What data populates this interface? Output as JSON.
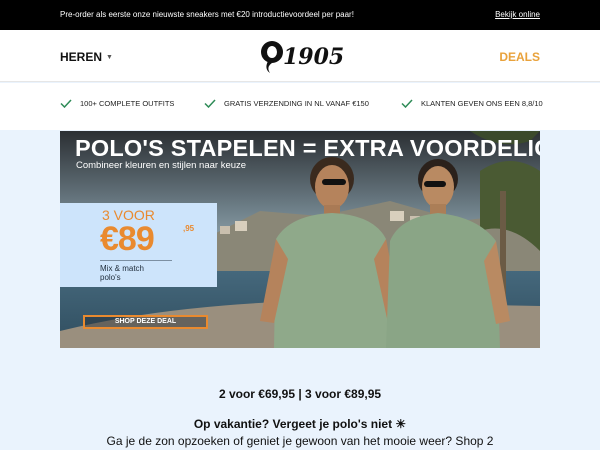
{
  "topbar": {
    "message": "Pre-order als eerste onze nieuwste sneakers met €20 introductievoordeel per paar!",
    "view_online": "Bekijk online"
  },
  "header": {
    "menu_label": "HEREN",
    "logo_text": "1905",
    "deals_label": "DEALS"
  },
  "usps": [
    {
      "icon": "check-icon",
      "text": "100+ COMPLETE OUTFITS"
    },
    {
      "icon": "check-icon",
      "text": "GRATIS VERZENDING IN NL VANAF €150"
    },
    {
      "icon": "check-icon",
      "text": "KLANTEN GEVEN ONS EEN 8,8/10"
    }
  ],
  "hero": {
    "title": "POLO'S STAPELEN = EXTRA VOORDELIG",
    "subtitle": "Combineer kleuren en stijlen naar keuze",
    "promo_qty": "3 VOOR",
    "promo_price": "€89",
    "promo_cents": ",95",
    "promo_note": "Mix & match polo's",
    "cta": "SHOP DEZE DEAL"
  },
  "deal_prices": "2 voor €69,95 | 3 voor €89,95",
  "vacation": {
    "title": "Op vakantie? Vergeet je polo's niet ☀",
    "body": "Ga je de zon opzoeken of geniet je gewoon van het mooie weer? Shop 2"
  },
  "colors": {
    "accent_orange": "#e98a2f",
    "deals_orange": "#e9a23b",
    "check_green": "#2e8b57",
    "page_background": "#eaf3fd"
  }
}
